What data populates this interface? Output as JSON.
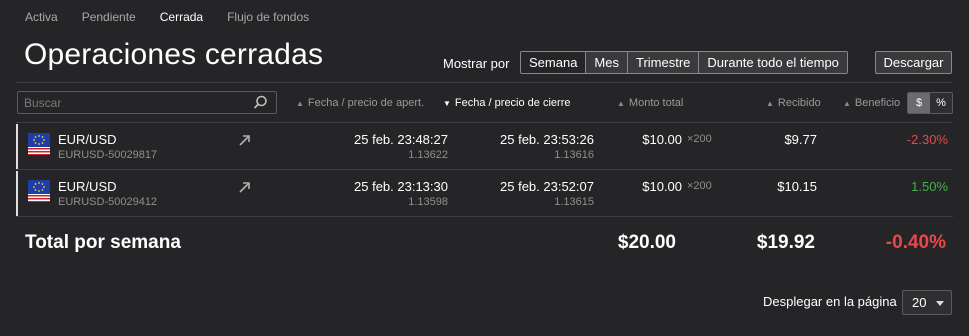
{
  "tabs": [
    "Activa",
    "Pendiente",
    "Cerrada",
    "Flujo de fondos"
  ],
  "active_tab": "Cerrada",
  "title": "Operaciones cerradas",
  "show_by_label": "Mostrar por",
  "periods": [
    "Semana",
    "Mes",
    "Trimestre",
    "Durante todo el tiempo"
  ],
  "active_period": "Semana",
  "download_label": "Descargar",
  "search": {
    "placeholder": "Buscar",
    "value": ""
  },
  "columns": {
    "open": "Fecha / precio de apert.",
    "close": "Fecha / precio de cierre",
    "amount": "Monto total",
    "received": "Recibido",
    "profit": "Beneficio"
  },
  "sorted_column": "close",
  "unit_toggle": {
    "dollar": "$",
    "percent": "%",
    "selected": "dollar"
  },
  "rows": [
    {
      "pair": "EUR/USD",
      "id": "EURUSD-50029817",
      "open_date": "25 feb. 23:48:27",
      "open_price": "1.13622",
      "close_date": "25 feb. 23:53:26",
      "close_price": "1.13616",
      "amount": "$10.00",
      "leverage": "×200",
      "received": "$9.77",
      "profit": "-2.30%",
      "profit_sign": "negative"
    },
    {
      "pair": "EUR/USD",
      "id": "EURUSD-50029412",
      "open_date": "25 feb. 23:13:30",
      "open_price": "1.13598",
      "close_date": "25 feb. 23:52:07",
      "close_price": "1.13615",
      "amount": "$10.00",
      "leverage": "×200",
      "received": "$10.15",
      "profit": "1.50%",
      "profit_sign": "positive"
    }
  ],
  "total": {
    "label": "Total por semana",
    "amount": "$20.00",
    "received": "$19.92",
    "profit": "-0.40%"
  },
  "per_page": {
    "label": "Desplegar en la página",
    "value": "20"
  },
  "colors": {
    "background": "#252527",
    "negative": "#e8484a",
    "positive": "#44b14b"
  }
}
